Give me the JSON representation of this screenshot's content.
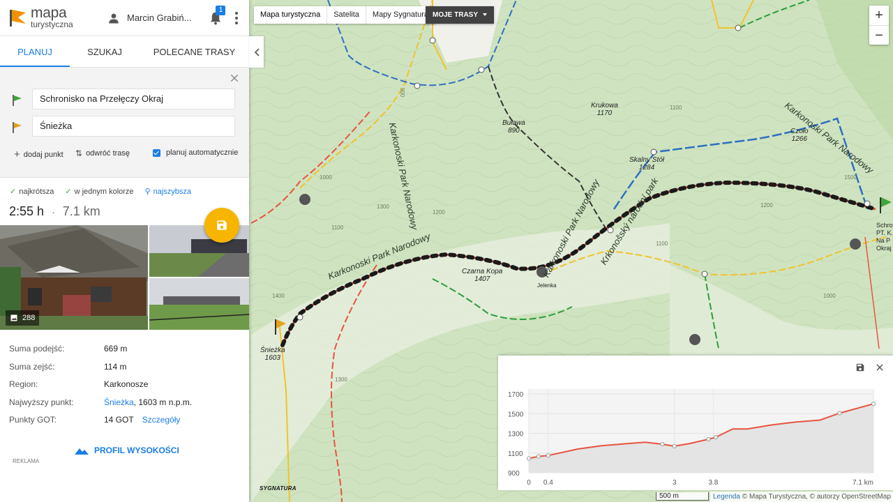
{
  "app": {
    "logo_line1": "mapa",
    "logo_line2": "turystyczna",
    "user_name": "Marcin Grabiń...",
    "notification_count": "1"
  },
  "tabs": [
    {
      "label": "PLANUJ",
      "active": true
    },
    {
      "label": "SZUKAJ",
      "active": false
    },
    {
      "label": "POLECANE TRASY",
      "active": false
    }
  ],
  "planner": {
    "start": "Schronisko na Przełęczy Okraj",
    "end": "Śnieżka",
    "add_point": "dodaj punkt",
    "reverse": "odwróć trasę",
    "auto_plan": "planuj automatycznie"
  },
  "route_options": [
    {
      "label": "najkrótsza",
      "state": "checked"
    },
    {
      "label": "w jednym kolorze",
      "state": "checked"
    },
    {
      "label": "najszybsza",
      "state": "selected"
    }
  ],
  "summary": {
    "time": "2:55 h",
    "separator": "·",
    "distance": "7.1 km"
  },
  "photos": {
    "count": "288"
  },
  "details": [
    {
      "key": "Suma podejść:",
      "value": "669 m"
    },
    {
      "key": "Suma zejść:",
      "value": "114 m"
    },
    {
      "key": "Region:",
      "value": "Karkonosze"
    },
    {
      "key": "Najwyższy punkt:",
      "link": "Śnieżka",
      "value": ", 1603 m n.p.m."
    },
    {
      "key": "Punkty GOT:",
      "value": "14 GOT",
      "link": "Szczegóły"
    }
  ],
  "profile_button": "PROFIL WYSOKOŚCI",
  "ad_label": "REKLAMA",
  "map": {
    "layers": [
      "Mapa turystyczna",
      "Satelita",
      "Mapy Sygnatura"
    ],
    "active_layer": "Mapa turystyczna",
    "my_routes": "MOJE TRASY",
    "zoom_in": "+",
    "zoom_out": "−",
    "scale": "500 m",
    "legend": "Legenda",
    "attribution": " © Mapa Turystyczna, © autorzy OpenStreetMap",
    "brand": "SYGNATURA",
    "labels": {
      "krukowa": "Krukowa",
      "krukowa_h": "1170",
      "bulawa": "Buława",
      "bulawa_h": "890",
      "czolo": "Czoło",
      "czolo_h": "1266",
      "skalny": "Skalny Stół",
      "skalny_h": "1284",
      "czarna": "Czarna Kopa",
      "czarna_h": "1407",
      "jelenka": "Jelenka",
      "sniezka": "Śnieżka",
      "sniezka_h": "1603",
      "okraj1": "Schroni",
      "okraj2": "PT. K. Na P",
      "okraj3": "Okraj",
      "park1": "Karkonoski Park Narodowy",
      "park2": "Karkonoski Park Narodowy",
      "park3": "Karkonoski Park Narodowy",
      "park4": "Karkonoski Park Narodowy",
      "park5": "Krkonošský národní park",
      "c900a": "900",
      "c1100a": "1100",
      "c1200a": "1200",
      "c1300a": "1300",
      "c1400a": "1400",
      "c1500a": "1500",
      "c1000a": "1000",
      "c1100b": "1100",
      "c1200b": "1200",
      "c1300b": "1300",
      "c1000b": "1000",
      "c1100c": "1100"
    }
  },
  "colors": {
    "accent": "#1a7ee6",
    "fab": "#f7b500",
    "route": "#e8533f",
    "map_green": "#cfe3c0"
  },
  "chart_data": {
    "type": "area",
    "title": "",
    "xlabel": "",
    "ylabel": "",
    "x_ticks": [
      "0",
      "0.4",
      "3",
      "3.8",
      "7.1 km"
    ],
    "y_ticks": [
      "900",
      "1100",
      "1300",
      "1500",
      "1700"
    ],
    "ylim": [
      900,
      1750
    ],
    "xlim": [
      0,
      7.1
    ],
    "x": [
      0,
      0.2,
      0.4,
      1.0,
      1.5,
      2.0,
      2.4,
      2.75,
      3.0,
      3.3,
      3.7,
      3.85,
      4.2,
      4.5,
      5.0,
      5.5,
      6.0,
      6.4,
      7.1
    ],
    "y": [
      1045,
      1065,
      1075,
      1140,
      1175,
      1195,
      1210,
      1190,
      1170,
      1195,
      1240,
      1260,
      1345,
      1345,
      1385,
      1415,
      1435,
      1505,
      1600
    ],
    "marker_x": [
      0,
      0.2,
      0.4,
      2.75,
      3.0,
      3.7,
      3.85,
      6.4,
      7.1
    ],
    "grid": true
  }
}
